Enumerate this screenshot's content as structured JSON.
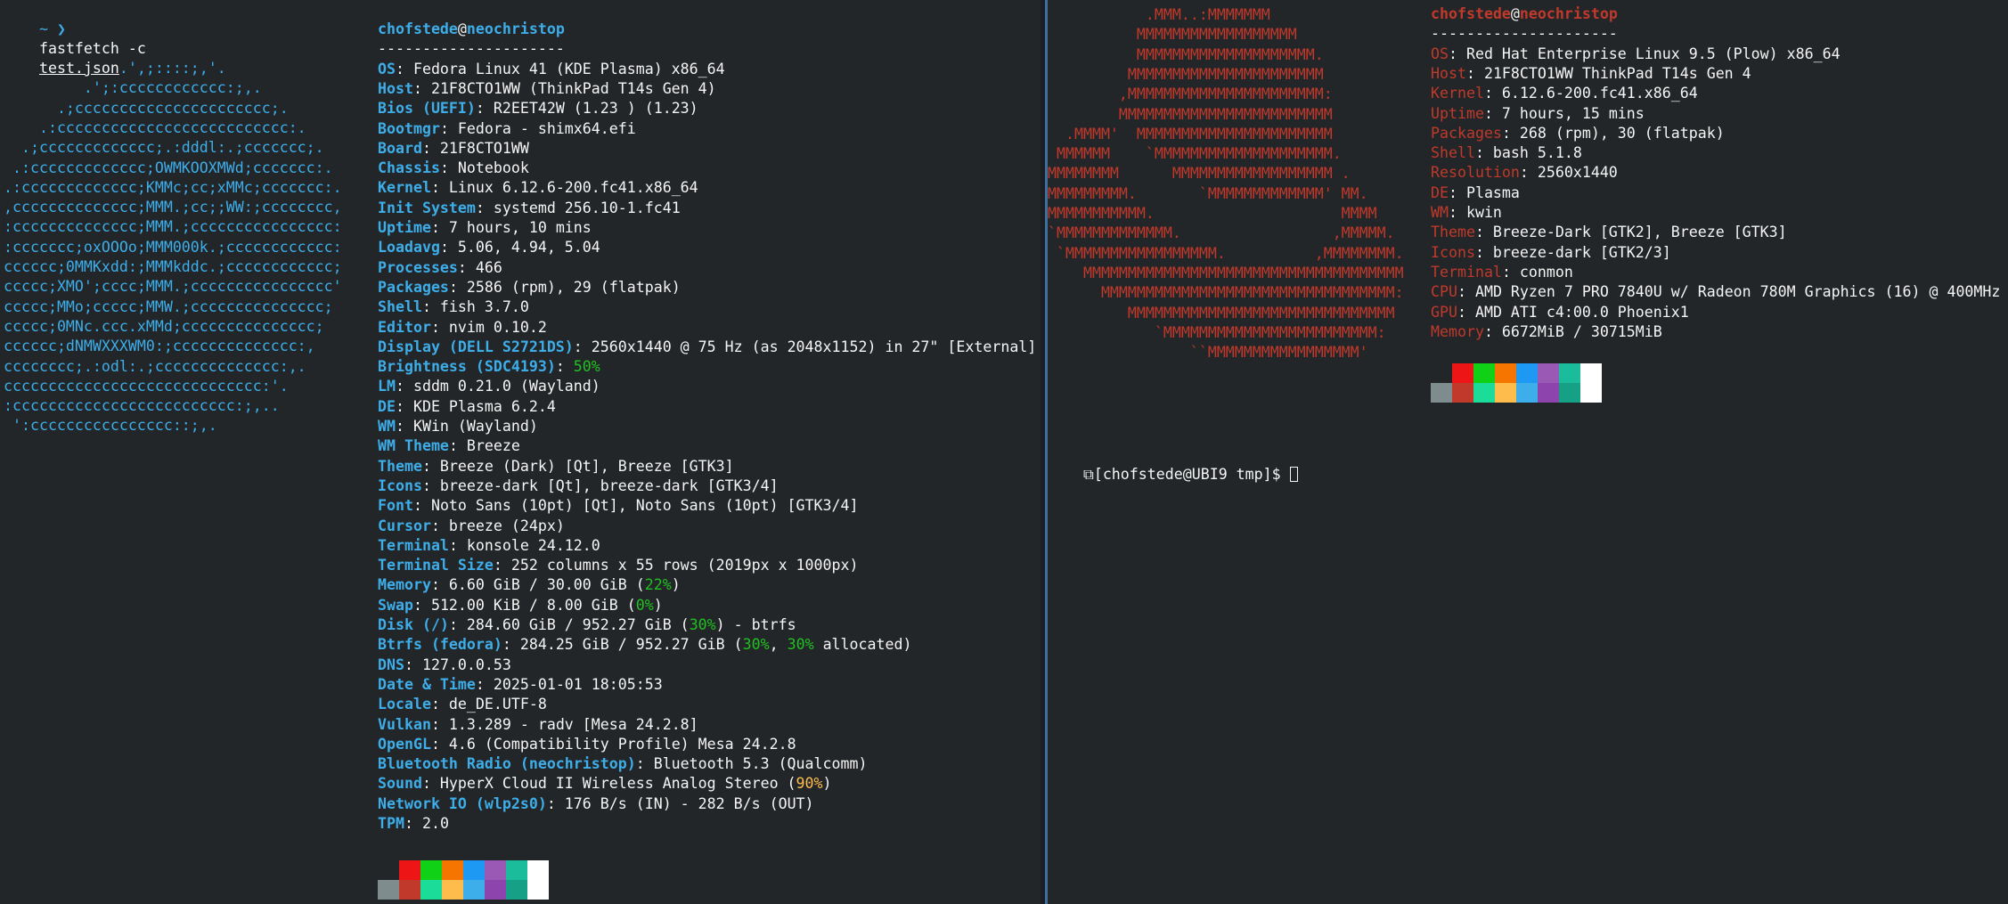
{
  "colors": {
    "background": "#232629",
    "label_blue": "#3daee9",
    "label_red": "#c0392b",
    "divider_accent": "#3d6fa0",
    "swatches_top": [
      "#232629",
      "#ed1515",
      "#11d116",
      "#f67400",
      "#1d99f3",
      "#9b59b6",
      "#1abc9c",
      "#ffffff"
    ],
    "swatches_bottom": [
      "#7f8c8d",
      "#c0392b",
      "#1cdc9a",
      "#fdbc4b",
      "#3daee9",
      "#8e44ad",
      "#16a085",
      "#ffffff"
    ]
  },
  "left": {
    "prompt": {
      "symbol": "~ ❯",
      "cmd": "fastfetch -c",
      "file": "test.json"
    },
    "user": "chofstede",
    "at": "@",
    "host": "neochristop",
    "separator": "---------------------",
    "logo_lines": [
      "             .',;::::;,'.",
      "         .';:cccccccccccc:;,.",
      "      .;cccccccccccccccccccccc;.",
      "    .:cccccccccccccccccccccccccc:.",
      "  .;ccccccccccccc;.:dddl:.;ccccccc;.",
      " .:ccccccccccccc;OWMKOOXMWd;ccccccc:.",
      ".:ccccccccccccc;KMMc;cc;xMMc;ccccccc:.",
      ",cccccccccccccc;MMM.;cc;;WW:;cccccccc,",
      ":cccccccccccccc;MMM.;cccccccccccccccc:",
      ":ccccccc;oxOOOo;MMM000k.;cccccccccccc:",
      "cccccc;0MMKxdd:;MMMkddc.;cccccccccccc;",
      "ccccc;XMO';cccc;MMM.;cccccccccccccccc'",
      "ccccc;MMo;ccccc;MMW.;ccccccccccccccc;",
      "ccccc;0MNc.ccc.xMMd;ccccccccccccccc;",
      "cccccc;dNMWXXXWM0:;cccccccccccccc:,",
      "cccccccc;.:odl:.;cccccccccccccc:,.",
      "ccccccccccccccccccccccccccccc:'.",
      ":ccccccccccccccccccccccccc:;,..",
      " ':cccccccccccccccc::;,."
    ],
    "info": [
      {
        "k": "OS",
        "v": ": Fedora Linux 41 (KDE Plasma) x86_64"
      },
      {
        "k": "Host",
        "v": ": 21F8CTO1WW (ThinkPad T14s Gen 4)"
      },
      {
        "k": "Bios (UEFI)",
        "v": ": R2EET42W (1.23 ) (1.23)"
      },
      {
        "k": "Bootmgr",
        "v": ": Fedora - shimx64.efi"
      },
      {
        "k": "Board",
        "v": ": 21F8CTO1WW"
      },
      {
        "k": "Chassis",
        "v": ": Notebook"
      },
      {
        "k": "Kernel",
        "v": ": Linux 6.12.6-200.fc41.x86_64"
      },
      {
        "k": "Init System",
        "v": ": systemd 256.10-1.fc41"
      },
      {
        "k": "Uptime",
        "v": ": 7 hours, 10 mins"
      },
      {
        "k": "Loadavg",
        "v": ": 5.06, 4.94, 5.04"
      },
      {
        "k": "Processes",
        "v": ": 466"
      },
      {
        "k": "Packages",
        "v": ": 2586 (rpm), 29 (flatpak)"
      },
      {
        "k": "Shell",
        "v": ": fish 3.7.0"
      },
      {
        "k": "Editor",
        "v": ": nvim 0.10.2"
      },
      {
        "k": "Display (DELL S2721DS)",
        "v": ": 2560x1440 @ 75 Hz (as 2048x1152) in 27\" [External]"
      },
      {
        "k": "Brightness (SDC4193)",
        "v": ": ",
        "pct": "50%",
        "pct_color": "green"
      },
      {
        "k": "LM",
        "v": ": sddm 0.21.0 (Wayland)"
      },
      {
        "k": "DE",
        "v": ": KDE Plasma 6.2.4"
      },
      {
        "k": "WM",
        "v": ": KWin (Wayland)"
      },
      {
        "k": "WM Theme",
        "v": ": Breeze"
      },
      {
        "k": "Theme",
        "v": ": Breeze (Dark) [Qt], Breeze [GTK3]"
      },
      {
        "k": "Icons",
        "v": ": breeze-dark [Qt], breeze-dark [GTK3/4]"
      },
      {
        "k": "Font",
        "v": ": Noto Sans (10pt) [Qt], Noto Sans (10pt) [GTK3/4]"
      },
      {
        "k": "Cursor",
        "v": ": breeze (24px)"
      },
      {
        "k": "Terminal",
        "v": ": konsole 24.12.0"
      },
      {
        "k": "Terminal Size",
        "v": ": 252 columns x 55 rows (2019px x 1000px)"
      },
      {
        "k": "Memory",
        "v": ": 6.60 GiB / 30.00 GiB (",
        "pct": "22%",
        "pct_color": "green",
        "tail": ")"
      },
      {
        "k": "Swap",
        "v": ": 512.00 KiB / 8.00 GiB (",
        "pct": "0%",
        "pct_color": "green",
        "tail": ")"
      },
      {
        "k": "Disk (/)",
        "v": ": 284.60 GiB / 952.27 GiB (",
        "pct": "30%",
        "pct_color": "green",
        "tail": ") - btrfs"
      },
      {
        "k": "Btrfs (fedora)",
        "v": ": 284.25 GiB / 952.27 GiB (",
        "pct": "30%",
        "pct_color": "green",
        "mid": ", ",
        "pct2": "30%",
        "tail": " allocated)"
      },
      {
        "k": "DNS",
        "v": ": 127.0.0.53"
      },
      {
        "k": "Date & Time",
        "v": ": 2025-01-01 18:05:53"
      },
      {
        "k": "Locale",
        "v": ": de_DE.UTF-8"
      },
      {
        "k": "Vulkan",
        "v": ": 1.3.289 - radv [Mesa 24.2.8]"
      },
      {
        "k": "OpenGL",
        "v": ": 4.6 (Compatibility Profile) Mesa 24.2.8"
      },
      {
        "k": "Bluetooth Radio (neochristop)",
        "v": ": Bluetooth 5.3 (Qualcomm)"
      },
      {
        "k": "Sound",
        "v": ": HyperX Cloud II Wireless Analog Stereo (",
        "pct": "90%",
        "pct_color": "yellow",
        "tail": ")"
      },
      {
        "k": "Network IO (wlp2s0)",
        "v": ": 176 B/s (IN) - 282 B/s (OUT)"
      },
      {
        "k": "TPM",
        "v": ": 2.0"
      }
    ]
  },
  "right": {
    "user": "chofstede",
    "at": "@",
    "host": "neochristop",
    "separator": "---------------------",
    "logo_lines": [
      "           .MMM..:MMMMMMM",
      "          MMMMMMMMMMMMMMMMMM",
      "          MMMMMMMMMMMMMMMMMMMM.",
      "         MMMMMMMMMMMMMMMMMMMMMM",
      "        ,MMMMMMMMMMMMMMMMMMMMMM:",
      "        MMMMMMMMMMMMMMMMMMMMMMMM",
      "  .MMMM'  MMMMMMMMMMMMMMMMMMMMMM",
      " MMMMMM    `MMMMMMMMMMMMMMMMMMMM.",
      "MMMMMMMM      MMMMMMMMMMMMMMMMMM .",
      "MMMMMMMMM.       `MMMMMMMMMMMMM' MM.",
      "MMMMMMMMMMM.                     MMMM",
      "`MMMMMMMMMMMMM.                 ,MMMMM.",
      " `MMMMMMMMMMMMMMMMM.          ,MMMMMMMM.",
      "    MMMMMMMMMMMMMMMMMMMMMMMMMMMMMMMMMMMM",
      "      MMMMMMMMMMMMMMMMMMMMMMMMMMMMMMMMM:",
      "         MMMMMMMMMMMMMMMMMMMMMMMMMMMMMM",
      "            `MMMMMMMMMMMMMMMMMMMMMMMM:",
      "                ``MMMMMMMMMMMMMMMMM'"
    ],
    "info": [
      {
        "k": "OS",
        "v": ": Red Hat Enterprise Linux 9.5 (Plow) x86_64"
      },
      {
        "k": "Host",
        "v": ": 21F8CTO1WW ThinkPad T14s Gen 4"
      },
      {
        "k": "Kernel",
        "v": ": 6.12.6-200.fc41.x86_64"
      },
      {
        "k": "Uptime",
        "v": ": 7 hours, 15 mins"
      },
      {
        "k": "Packages",
        "v": ": 268 (rpm), 30 (flatpak)"
      },
      {
        "k": "Shell",
        "v": ": bash 5.1.8"
      },
      {
        "k": "Resolution",
        "v": ": 2560x1440"
      },
      {
        "k": "DE",
        "v": ": Plasma"
      },
      {
        "k": "WM",
        "v": ": kwin"
      },
      {
        "k": "Theme",
        "v": ": Breeze-Dark [GTK2], Breeze [GTK3]"
      },
      {
        "k": "Icons",
        "v": ": breeze-dark [GTK2/3]"
      },
      {
        "k": "Terminal",
        "v": ": conmon"
      },
      {
        "k": "CPU",
        "v": ": AMD Ryzen 7 PRO 7840U w/ Radeon 780M Graphics (16) @ 400MHz"
      },
      {
        "k": "GPU",
        "v": ": AMD ATI c4:00.0 Phoenix1"
      },
      {
        "k": "Memory",
        "v": ": 6672MiB / 30715MiB"
      }
    ],
    "shell_prompt": "[chofstede@UBI9 tmp]$ "
  }
}
